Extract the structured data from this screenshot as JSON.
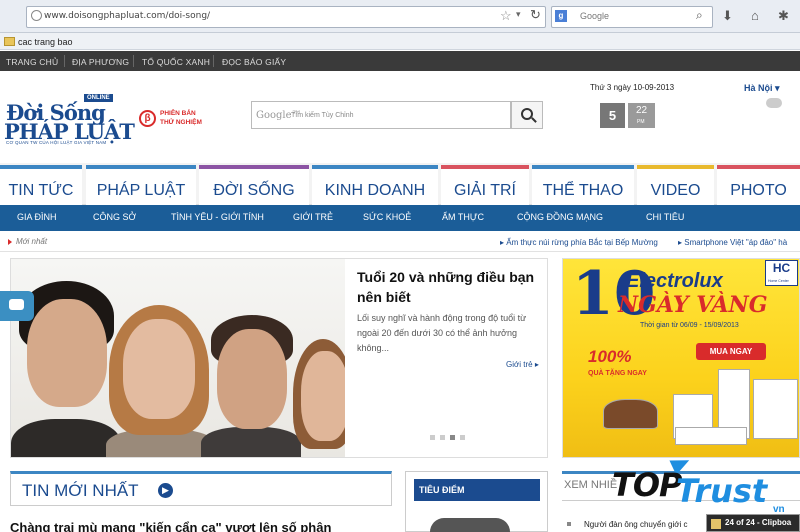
{
  "browser": {
    "url": "www.doisongphapluat.com/doi-song/",
    "search_engine": "Google",
    "bookmark": "cac trang bao"
  },
  "top_nav": [
    "TRANG CHỦ",
    "ĐỊA PHƯƠNG",
    "TỔ QUỐC XANH",
    "ĐỌC BÁO GIẤY"
  ],
  "logo": {
    "line1": "Đời Sống",
    "line2": "PHÁP LUẬT",
    "badge": "ONLINE",
    "tagline": "CƠ QUAN TW CỦA HỘI LUẬT GIA VIỆT NAM",
    "beta_line1": "PHIÊN BẢN",
    "beta_line2": "THỬ NGHIỆM"
  },
  "search": {
    "brand": "Google™",
    "placeholder": "Tìm kiếm Tùy Chỉnh"
  },
  "header": {
    "date": "Thứ 3 ngày 10-09-2013",
    "city": "Hà Nội",
    "weather_num1": "5",
    "weather_num2": "22",
    "weather_pm": "PM"
  },
  "categories": [
    {
      "label": "TIN TỨC",
      "color": "#3c86c3"
    },
    {
      "label": "PHÁP LUẬT",
      "color": "#3c86c3"
    },
    {
      "label": "ĐỜI SỐNG",
      "color": "#8c54a4"
    },
    {
      "label": "KINH DOANH",
      "color": "#3c86c3"
    },
    {
      "label": "GIẢI TRÍ",
      "color": "#d9535f"
    },
    {
      "label": "THỂ THAO",
      "color": "#3c86c3"
    },
    {
      "label": "VIDEO",
      "color": "#e8b92d"
    },
    {
      "label": "PHOTO",
      "color": "#d9535f"
    }
  ],
  "subnav": [
    "GIA ĐÌNH",
    "CÔNG SỞ",
    "TÌNH YÊU - GIỚI TÍNH",
    "GIỚI TRẺ",
    "SỨC KHOẺ",
    "ẨM THỰC",
    "CỘNG ĐỒNG MẠNG",
    "CHI TIÊU"
  ],
  "breadcrumb": "Mới nhất",
  "ticker": [
    "Ẩm thực núi rừng phía Bắc tại Bếp Mường",
    "Smartphone Việt \"áp đảo\" hà"
  ],
  "hero": {
    "title": "Tuổi 20 và những điều bạn nên biết",
    "desc": "Lối suy nghĩ và hành động trong độ tuổi từ ngoài 20 đến dưới 30 có thể ảnh hưởng không...",
    "link": "Giới trẻ",
    "slides": 4,
    "active_slide": 3
  },
  "ad": {
    "number": "10",
    "brand": "Electrolux",
    "headline": "NGÀY VÀNG",
    "period": "Thời gian từ 06/09 - 15/09/2013",
    "button": "MUA NGAY",
    "promo": "100%",
    "gift": "QUÀ TẶNG NGAY",
    "store": "HC",
    "store_sub": "Home Center"
  },
  "sections": {
    "latest_title": "TIN MỚI NHẤT",
    "latest_headline": "Chàng trai mù mang \"kiến cẩn ca\" vượt lên số phận",
    "focus_title": "TIÊU ĐIỂM",
    "more_title": "XEM NHIỀ",
    "more_item": "Người đàn ông chuyển giới c"
  },
  "watermark": {
    "part1": "TOP",
    "part2": "Trust",
    "suffix": "vn"
  },
  "taskbar_popup": "24 of 24 - Clipboa"
}
